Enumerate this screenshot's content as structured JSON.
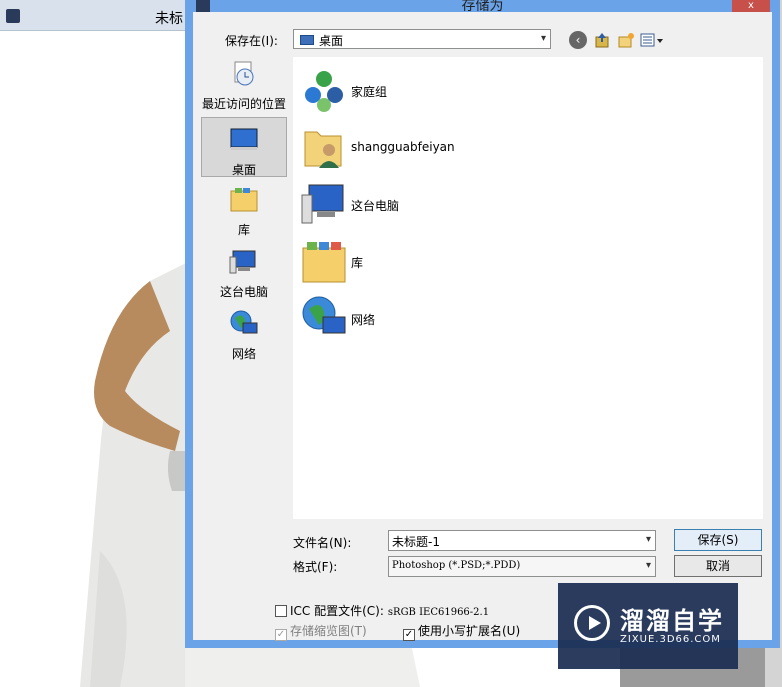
{
  "background_window": {
    "title": "未标"
  },
  "dialog": {
    "title": "存储为",
    "close_label": "x",
    "look_in": {
      "label": "保存在(I):",
      "value": "桌面"
    },
    "places": [
      {
        "label": "最近访问的位置",
        "icon": "recent-places-icon"
      },
      {
        "label": "桌面",
        "icon": "desktop-icon",
        "selected": true
      },
      {
        "label": "库",
        "icon": "library-icon"
      },
      {
        "label": "这台电脑",
        "icon": "computer-icon"
      },
      {
        "label": "网络",
        "icon": "network-icon"
      }
    ],
    "files": [
      {
        "label": "家庭组",
        "icon": "homegroup-icon"
      },
      {
        "label": "shangguabfeiyan",
        "icon": "user-folder-icon"
      },
      {
        "label": "这台电脑",
        "icon": "computer-icon"
      },
      {
        "label": "库",
        "icon": "library-icon"
      },
      {
        "label": "网络",
        "icon": "network-icon"
      }
    ],
    "filename": {
      "label": "文件名(N):",
      "value": "未标题-1"
    },
    "format": {
      "label": "格式(F):",
      "value": "Photoshop (*.PSD;*.PDD)"
    },
    "save_label": "保存(S)",
    "cancel_label": "取消",
    "icc": {
      "label": "ICC 配置文件(C):",
      "profile": "sRGB IEC61966-2.1",
      "checked": false
    },
    "thumbnail": {
      "label": "存储缩览图(T)",
      "checked": true,
      "disabled": true
    },
    "lowercase_ext": {
      "label": "使用小写扩展名(U)",
      "checked": true
    }
  },
  "watermark": {
    "brand": "溜溜自学",
    "url": "ZIXUE.3D66.COM"
  }
}
